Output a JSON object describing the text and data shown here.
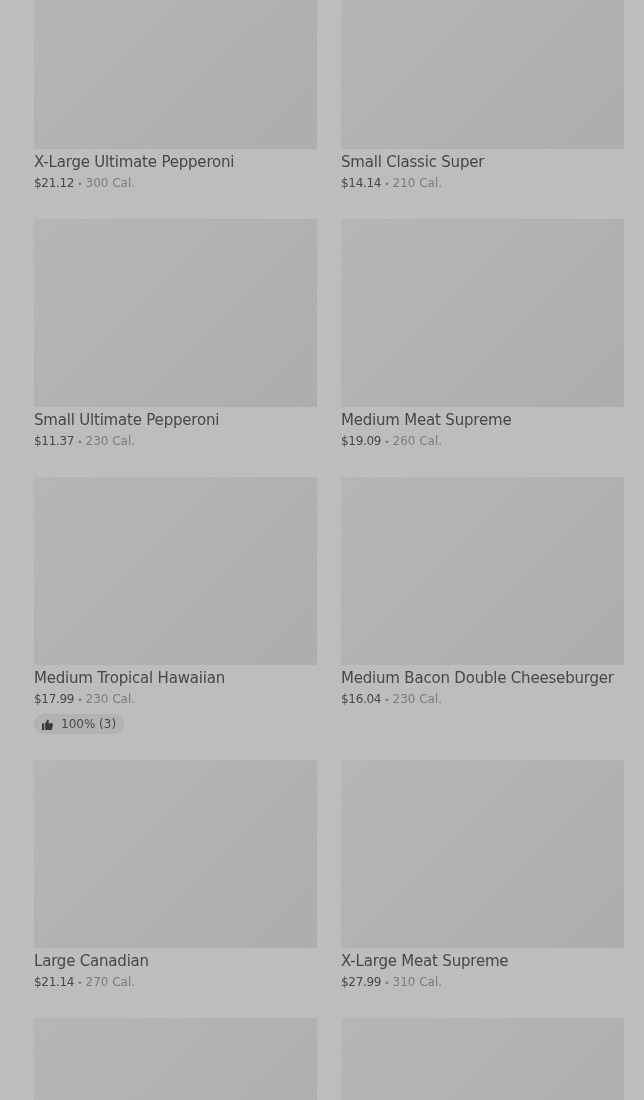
{
  "menu_items": [
    {
      "kind": "item",
      "name": "X-Large Ultimate Pepperoni",
      "price": "$21.12",
      "separator": "•",
      "calories": "300 Cal."
    },
    {
      "kind": "item",
      "name": "Small Classic Super",
      "price": "$14.14",
      "separator": "•",
      "calories": "210 Cal."
    },
    {
      "kind": "item",
      "name": "Small Ultimate Pepperoni",
      "price": "$11.37",
      "separator": "•",
      "calories": "230 Cal."
    },
    {
      "kind": "item",
      "name": "Medium Meat Supreme",
      "price": "$19.09",
      "separator": "•",
      "calories": "260 Cal."
    },
    {
      "kind": "item",
      "name": "Medium Tropical Hawaiian",
      "price": "$17.99",
      "separator": "•",
      "calories": "230 Cal.",
      "rating": "100% (3)"
    },
    {
      "kind": "item",
      "name": "Medium Bacon Double Cheeseburger",
      "price": "$16.04",
      "separator": "•",
      "calories": "230 Cal."
    },
    {
      "kind": "item",
      "name": "Large Canadian",
      "price": "$21.14",
      "separator": "•",
      "calories": "270 Cal."
    },
    {
      "kind": "item",
      "name": "X-Large Meat Supreme",
      "price": "$27.99",
      "separator": "•",
      "calories": "310 Cal."
    },
    {
      "kind": "image_only"
    },
    {
      "kind": "image_only"
    }
  ]
}
